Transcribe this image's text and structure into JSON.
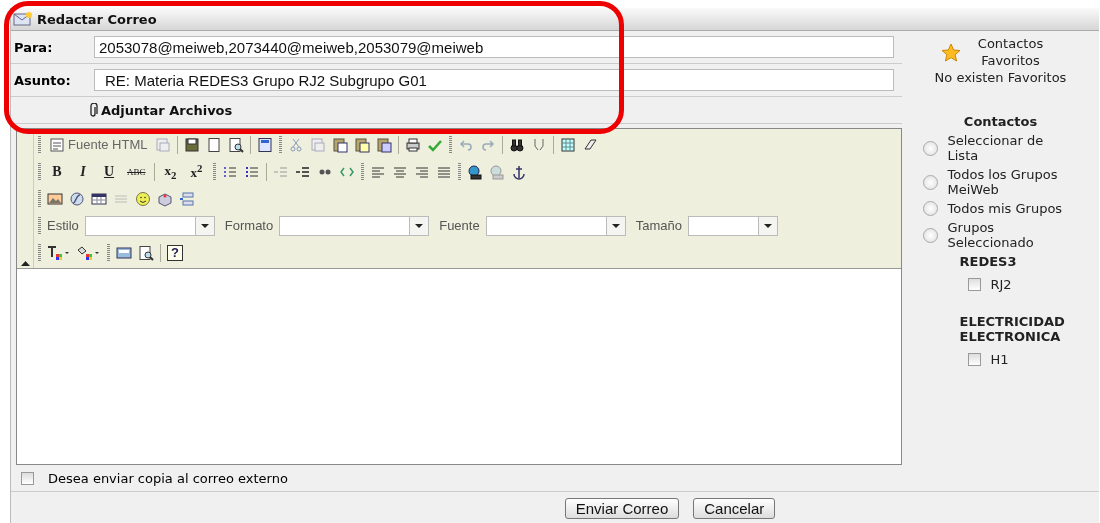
{
  "window": {
    "title": "Redactar Correo"
  },
  "form": {
    "to": {
      "label": "Para:",
      "value": "2053078@meiweb,2073440@meiweb,2053079@meiweb"
    },
    "subject": {
      "label": "Asunto:",
      "value": "RE: Materia REDES3 Grupo RJ2 Subgrupo G01"
    },
    "attach_link": "Adjuntar Archivos"
  },
  "editor": {
    "source_button": "Fuente HTML",
    "format_buttons": [
      "B",
      "I",
      "U",
      "ABC",
      "x$_{2}$",
      "x$^{2}$"
    ],
    "combos": [
      {
        "label": "Estilo"
      },
      {
        "label": "Formato"
      },
      {
        "label": "Fuente"
      },
      {
        "label": "Tamaño"
      }
    ],
    "help_button": "?"
  },
  "sidebar": {
    "favorites_title": "Contactos Favoritos",
    "favorites_empty": "No existen Favoritos",
    "contacts_title": "Contactos",
    "options": [
      {
        "label": "Seleccionar de Lista",
        "selected": false
      },
      {
        "label": "Todos los Grupos MeiWeb",
        "selected": false
      },
      {
        "label": "Todos mis Grupos",
        "selected": false
      },
      {
        "label": "Grupos Seleccionado",
        "selected": false
      }
    ],
    "groups": [
      {
        "name": "REDES3",
        "subgroups": [
          {
            "label": "RJ2",
            "checked": false
          }
        ]
      },
      {
        "name": "ELECTRICIDAD ELECTRONICA",
        "subgroups": [
          {
            "label": "H1",
            "checked": false
          }
        ]
      }
    ]
  },
  "external_copy": {
    "label": "Desea enviar copia al correo externo",
    "checked": false
  },
  "buttons": [
    "Enviar Correo",
    "Cancelar"
  ]
}
